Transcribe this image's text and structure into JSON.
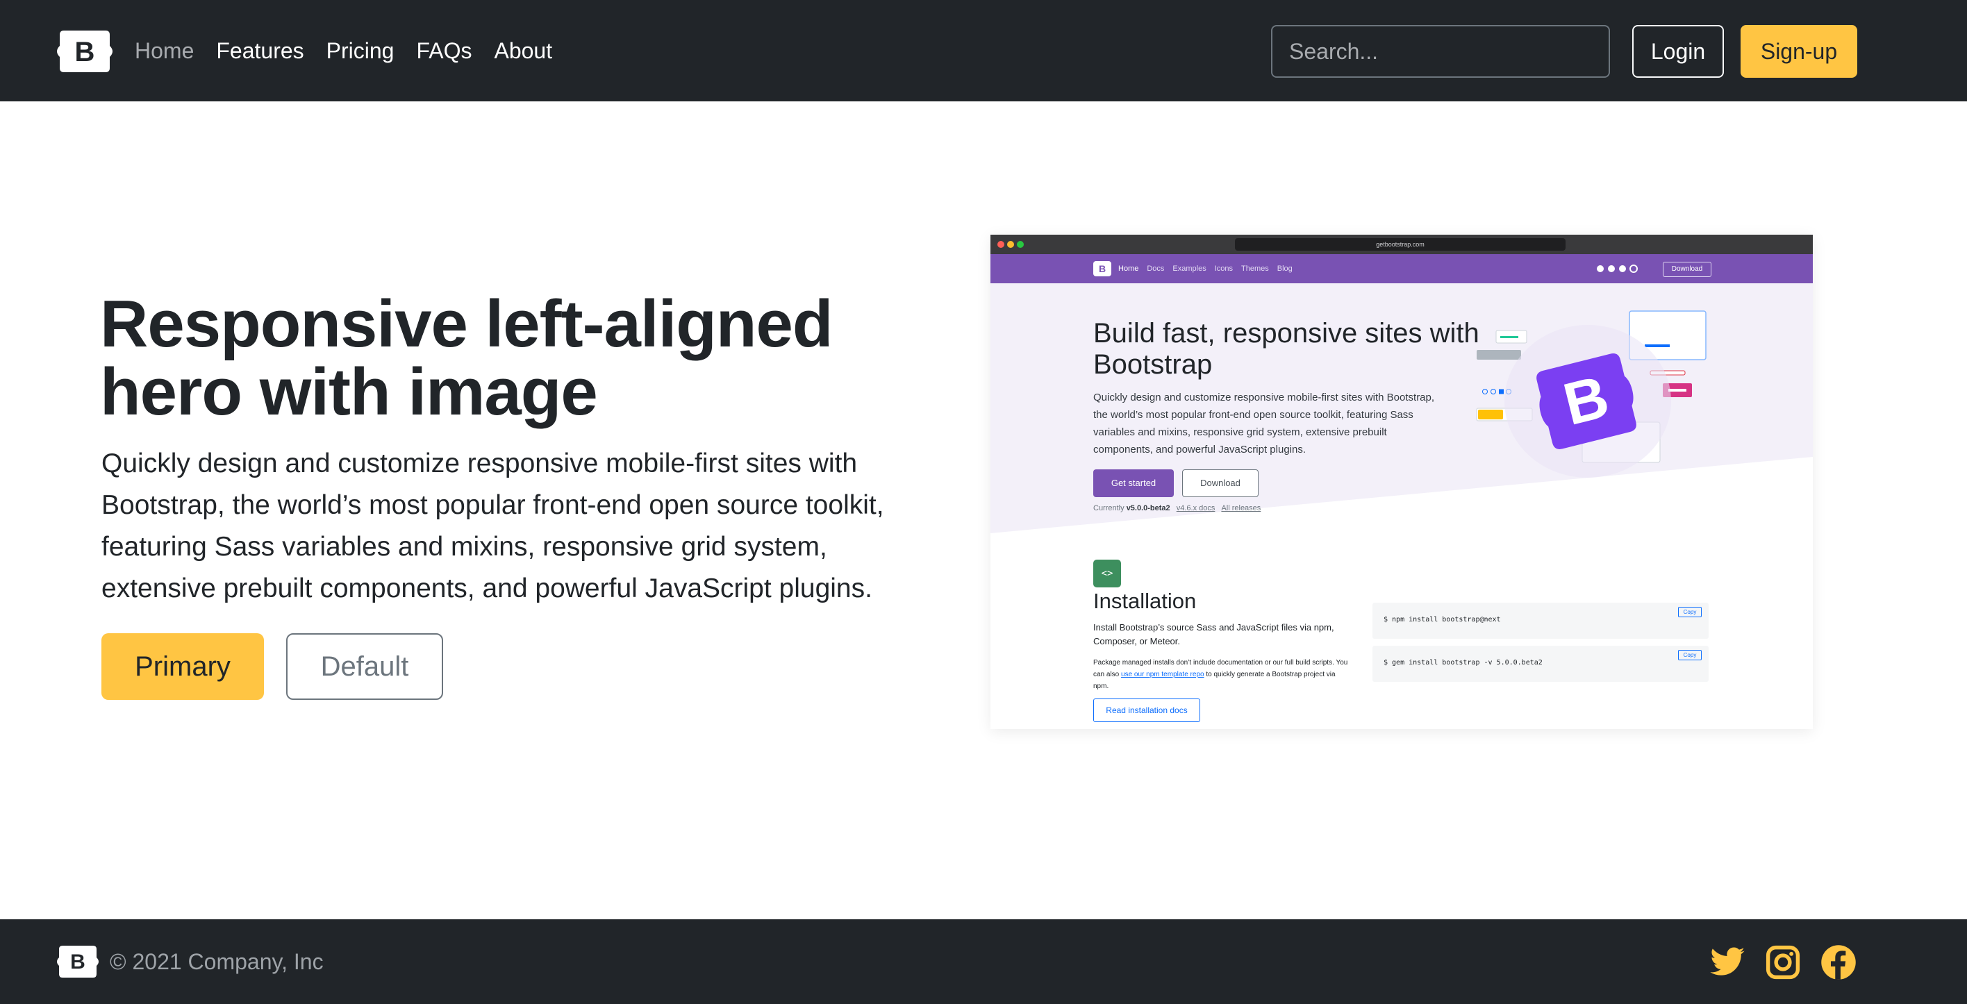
{
  "brand": {
    "logo_letter": "B"
  },
  "nav": {
    "links": [
      {
        "label": "Home",
        "active": true
      },
      {
        "label": "Features",
        "active": false
      },
      {
        "label": "Pricing",
        "active": false
      },
      {
        "label": "FAQs",
        "active": false
      },
      {
        "label": "About",
        "active": false
      }
    ],
    "search_placeholder": "Search...",
    "login_label": "Login",
    "signup_label": "Sign-up"
  },
  "hero": {
    "title": "Responsive left-aligned hero with image",
    "lead": "Quickly design and customize responsive mobile-first sites with Bootstrap, the world’s most popular front-end open source toolkit, featuring Sass variables and mixins, responsive grid system, extensive prebuilt components, and powerful JavaScript plugins.",
    "primary_label": "Primary",
    "default_label": "Default"
  },
  "mock": {
    "url": "getbootstrap.com",
    "nav_links": [
      "Home",
      "Docs",
      "Examples",
      "Icons",
      "Themes",
      "Blog"
    ],
    "download_label": "Download",
    "title": "Build fast, responsive sites with Bootstrap",
    "lead": "Quickly design and customize responsive mobile-first sites with Bootstrap, the world’s most popular front-end open source toolkit, featuring Sass variables and mixins, responsive grid system, extensive prebuilt components, and powerful JavaScript plugins.",
    "get_started_label": "Get started",
    "hero_download_label": "Download",
    "currently_prefix": "Currently",
    "version": "v5.0.0-beta2",
    "docs_link": "v4.6.x docs",
    "releases_link": "All releases",
    "install_icon": "<>",
    "install_title": "Installation",
    "install_p1": "Install Bootstrap’s source Sass and JavaScript files via npm, Composer, or Meteor.",
    "install_p2_a": "Package managed installs don’t include documentation or our full build scripts. You can also ",
    "install_p2_link": "use our npm template repo",
    "install_p2_b": " to quickly generate a Bootstrap project via npm.",
    "install_button": "Read installation docs",
    "code_1": "$ npm install bootstrap@next",
    "code_2": "$ gem install bootstrap -v 5.0.0.beta2",
    "copy_label": "Copy"
  },
  "footer": {
    "copyright": "© 2021 Company, Inc",
    "icons": [
      "twitter-icon",
      "instagram-icon",
      "facebook-icon"
    ]
  },
  "colors": {
    "dark": "#212529",
    "accent": "#ffc543",
    "muted": "#6c757d",
    "bootstrap_purple": "#7952b3"
  }
}
